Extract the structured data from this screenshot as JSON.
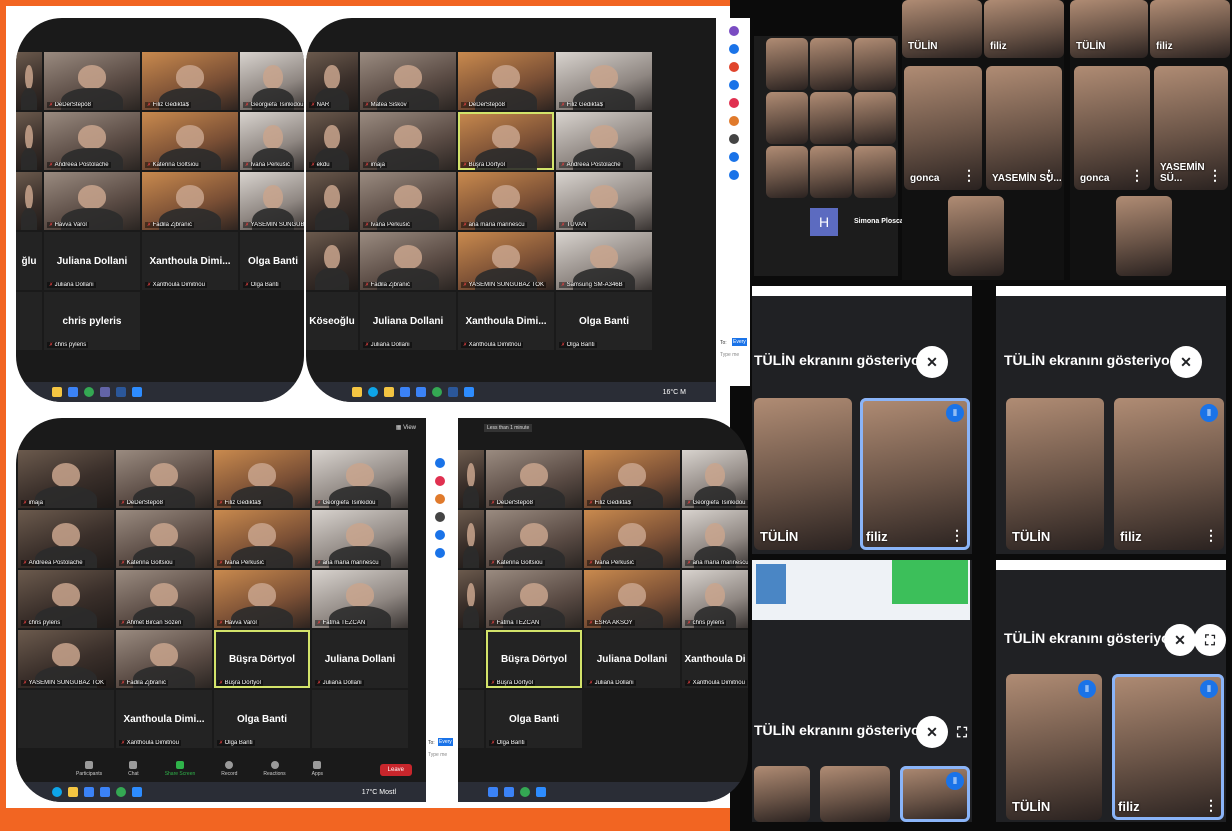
{
  "panel_tl": {
    "tiles": [
      {
        "label": "",
        "type": "video"
      },
      {
        "label": "DeDerStepö8",
        "type": "video"
      },
      {
        "label": "Filiz Gedikta$",
        "type": "video"
      },
      {
        "label": "Georgiefa Tsinkidou",
        "type": "video"
      },
      {
        "label": "",
        "type": "video"
      },
      {
        "label": "Andreea Postolache",
        "type": "video"
      },
      {
        "label": "Katerina Goltsiou",
        "type": "video"
      },
      {
        "label": "Ivana Perkušić",
        "type": "video"
      },
      {
        "label": "",
        "type": "video"
      },
      {
        "label": "Havva Varol",
        "type": "video"
      },
      {
        "label": "Fadila Zjbranić",
        "type": "video"
      },
      {
        "label": "YASEMİN SÜNGÜBAZ TOK",
        "type": "video"
      },
      {
        "label": "",
        "big": "ğlu"
      },
      {
        "label": "Juliana Dollani",
        "big": "Juliana  Dollani"
      },
      {
        "label": "Xanthoula Dimitriou",
        "big": "Xanthoula  Dimi..."
      },
      {
        "label": "Olga Banti",
        "big": "Olga Banti"
      },
      {
        "label": "",
        "big": ""
      },
      {
        "label": "chris pyleris",
        "big": "chris pyleris"
      }
    ]
  },
  "panel_tr": {
    "tiles": [
      {
        "label": "NAR",
        "type": "video"
      },
      {
        "label": "Matea Šiškov",
        "type": "video"
      },
      {
        "label": "DeDerStepö8",
        "type": "video"
      },
      {
        "label": "Filiz Gedikta$",
        "type": "video"
      },
      {
        "label": "ekdu",
        "type": "video"
      },
      {
        "label": "imaja",
        "type": "video"
      },
      {
        "label": "Büşra Dörtyol",
        "type": "video",
        "active": true
      },
      {
        "label": "Andreea Postolache",
        "type": "video"
      },
      {
        "label": "",
        "type": "video"
      },
      {
        "label": "Ivana Perkušić",
        "type": "video"
      },
      {
        "label": "ana maria marinescu",
        "type": "video"
      },
      {
        "label": "TÜVAN",
        "type": "video"
      },
      {
        "label": "",
        "type": "video"
      },
      {
        "label": "Fadila Zjbranić",
        "type": "video"
      },
      {
        "label": "YASEMİN SÜNGÜBAZ TOK",
        "type": "video"
      },
      {
        "label": "Samsung SM-A346B",
        "type": "video"
      },
      {
        "label": "",
        "big": "Köseoğlu"
      },
      {
        "label": "Juliana Dollani",
        "big": "Juliana  Dollani"
      },
      {
        "label": "Xanthoula Dimitriou",
        "big": "Xanthoula  Dimi..."
      },
      {
        "label": "Olga Banti",
        "big": "Olga Banti"
      }
    ],
    "chat_to": "To:",
    "chat_every": "Every",
    "chat_placeholder": "Type me",
    "weather": "16°C  M"
  },
  "panel_bl": {
    "view_label": "View",
    "tiles": [
      {
        "label": "imaja",
        "type": "video"
      },
      {
        "label": "DeDerStepö8",
        "type": "video"
      },
      {
        "label": "Filiz Gedikta$",
        "type": "video"
      },
      {
        "label": "Georgiefa Tsinkidou",
        "type": "video"
      },
      {
        "label": "Andreea Postolache",
        "type": "video"
      },
      {
        "label": "Katerina Goltsiou",
        "type": "video"
      },
      {
        "label": "Ivana Perkušić",
        "type": "video"
      },
      {
        "label": "ana maria marinescu",
        "type": "video"
      },
      {
        "label": "chris pyleris",
        "type": "video"
      },
      {
        "label": "Ahmet Bircan Sözeri",
        "type": "video"
      },
      {
        "label": "Havva Varol",
        "type": "video"
      },
      {
        "label": "Fatma TEZCAN",
        "type": "video"
      },
      {
        "label": "YASEMİN SÜNGÜBAZ TOK",
        "type": "video"
      },
      {
        "label": "Fadila Zjbranić",
        "type": "video"
      },
      {
        "label": "Büşra Dörtyol",
        "big": "Büşra Dörtyol",
        "active": true
      },
      {
        "label": "Juliana Dollani",
        "big": "Juliana  Dollani"
      },
      {
        "label": "",
        "big": ""
      },
      {
        "label": "Xanthoula Dimitriou",
        "big": "Xanthoula  Dimi..."
      },
      {
        "label": "Olga Banti",
        "big": "Olga Banti"
      },
      {
        "label": "",
        "big": ""
      }
    ],
    "toolbar": {
      "participants": "Participants",
      "participants_count": "22",
      "chat": "Chat",
      "share": "Share Screen",
      "record": "Record",
      "reactions": "Reactions",
      "apps": "Apps",
      "leave": "Leave"
    },
    "chat_to": "To:",
    "chat_every": "Every",
    "chat_placeholder": "Type me",
    "weather": "17°C  Mostl"
  },
  "panel_br": {
    "timer": "Less than 1 minute",
    "tiles": [
      {
        "label": "",
        "type": "video"
      },
      {
        "label": "DeDerStepö8",
        "type": "video"
      },
      {
        "label": "Filiz Gedikta$",
        "type": "video"
      },
      {
        "label": "Georgiefa Tsinkidou",
        "type": "video"
      },
      {
        "label": "",
        "type": "video"
      },
      {
        "label": "Katerina Goltsiou",
        "type": "video"
      },
      {
        "label": "Ivana Perkušić",
        "type": "video"
      },
      {
        "label": "ana maria marinescu",
        "type": "video"
      },
      {
        "label": "",
        "type": "video"
      },
      {
        "label": "Fatma TEZCAN",
        "type": "video"
      },
      {
        "label": "ESRA AKSOY",
        "type": "video"
      },
      {
        "label": "chris pyleris",
        "type": "video"
      },
      {
        "label": "",
        "big": ""
      },
      {
        "label": "Büşra Dörtyol",
        "big": "Büşra Dörtyol",
        "active": true
      },
      {
        "label": "Juliana Dollani",
        "big": "Juliana  Dollani"
      },
      {
        "label": "Xanthoula Dimitriou",
        "big": "Xanthoula  Di"
      },
      {
        "label": "",
        "big": ""
      },
      {
        "label": "Olga Banti",
        "big": "Olga Banti"
      }
    ]
  },
  "meet_top": {
    "name_tulin": "TÜLİN",
    "name_filiz": "filiz",
    "name_gonca": "gonca",
    "name_yasemin": "YASEMİN SÜ...",
    "h_avatar": "H",
    "simona": "Simona Plosca"
  },
  "meet": {
    "presenting": "TÜLİN ekranını gösteriyor",
    "name_tulin": "TÜLİN",
    "name_filiz": "filiz"
  }
}
